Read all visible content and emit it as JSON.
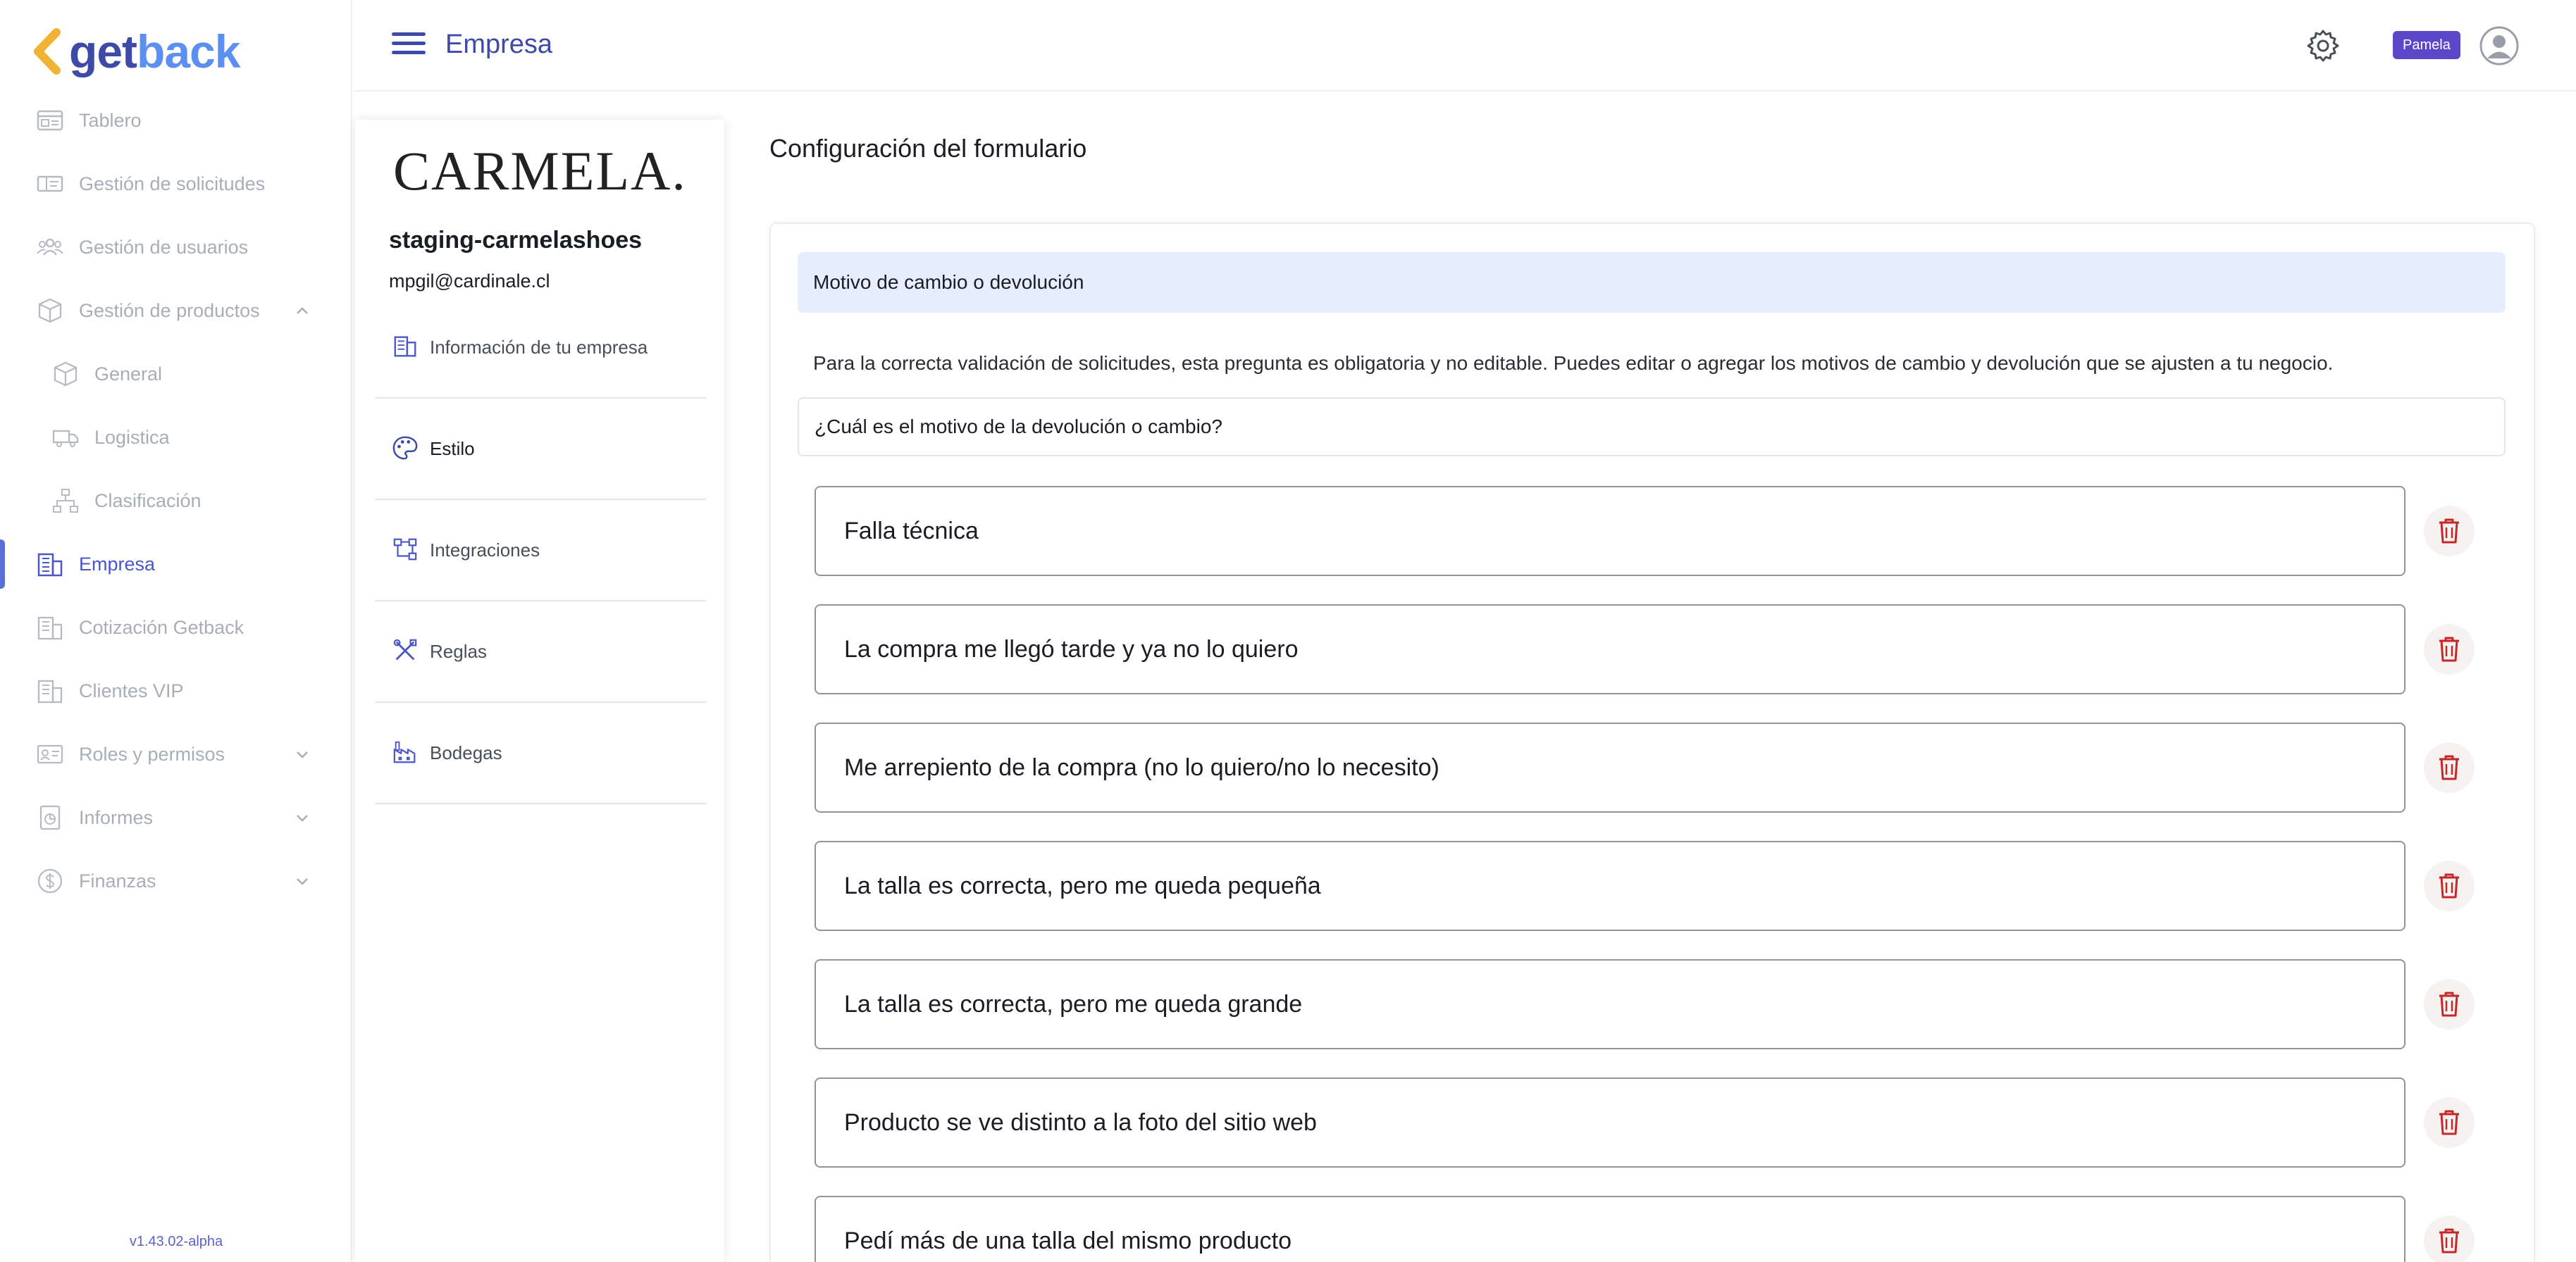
{
  "app": {
    "logo_part1": "get",
    "logo_part2": "back",
    "version": "v1.43.02-alpha"
  },
  "sidebar": {
    "items": [
      {
        "label": "Tablero",
        "icon": "dashboard-icon"
      },
      {
        "label": "Gestión de solicitudes",
        "icon": "ticket-icon"
      },
      {
        "label": "Gestión de usuarios",
        "icon": "users-icon"
      },
      {
        "label": "Gestión de productos",
        "icon": "box-icon"
      },
      {
        "label": "General",
        "icon": "cube-icon"
      },
      {
        "label": "Logistica",
        "icon": "truck-icon"
      },
      {
        "label": "Clasificación",
        "icon": "hierarchy-icon"
      },
      {
        "label": "Empresa",
        "icon": "building-icon"
      },
      {
        "label": "Cotización Getback",
        "icon": "building-icon"
      },
      {
        "label": "Clientes VIP",
        "icon": "building-icon"
      },
      {
        "label": "Roles y permisos",
        "icon": "id-card-icon"
      },
      {
        "label": "Informes",
        "icon": "report-icon"
      },
      {
        "label": "Finanzas",
        "icon": "dollar-icon"
      }
    ],
    "active_label": "Empresa"
  },
  "topbar": {
    "title": "Empresa",
    "user_badge": "Pamela"
  },
  "company": {
    "brand_logo_text": "CARMELA.",
    "name": "staging-carmelashoes",
    "email": "mpgil@cardinale.cl",
    "menu": [
      {
        "label": "Información de tu empresa",
        "icon": "building-icon"
      },
      {
        "label": "Estilo",
        "icon": "palette-icon"
      },
      {
        "label": "Integraciones",
        "icon": "integrations-icon"
      },
      {
        "label": "Reglas",
        "icon": "tools-icon"
      },
      {
        "label": "Bodegas",
        "icon": "factory-icon"
      }
    ],
    "selected": "Estilo"
  },
  "main": {
    "heading": "Configuración del formulario",
    "section_title": "Motivo de cambio o devolución",
    "help_text": "Para la correcta validación de solicitudes, esta pregunta es obligatoria y no editable. Puedes editar o agregar los motivos de cambio y devolución que se ajusten a tu negocio.",
    "question": "¿Cuál es el motivo de la devolución o cambio?",
    "reasons": [
      "Falla técnica",
      "La compra me llegó tarde y ya no lo quiero",
      "Me arrepiento de la compra (no lo quiero/no lo necesito)",
      "La talla es correcta, pero me queda pequeña",
      "La talla es correcta, pero me queda grande",
      "Producto se ve distinto a la foto del sitio web",
      "Pedí más de una talla del mismo producto"
    ]
  },
  "colors": {
    "brand_dark": "#3d4aa8",
    "brand_light": "#5b8ff0",
    "logo_chevron": "#f2b233",
    "section_bg": "#e6edfd",
    "delete_red": "#c62828",
    "badge_bg": "#5b47c9"
  }
}
